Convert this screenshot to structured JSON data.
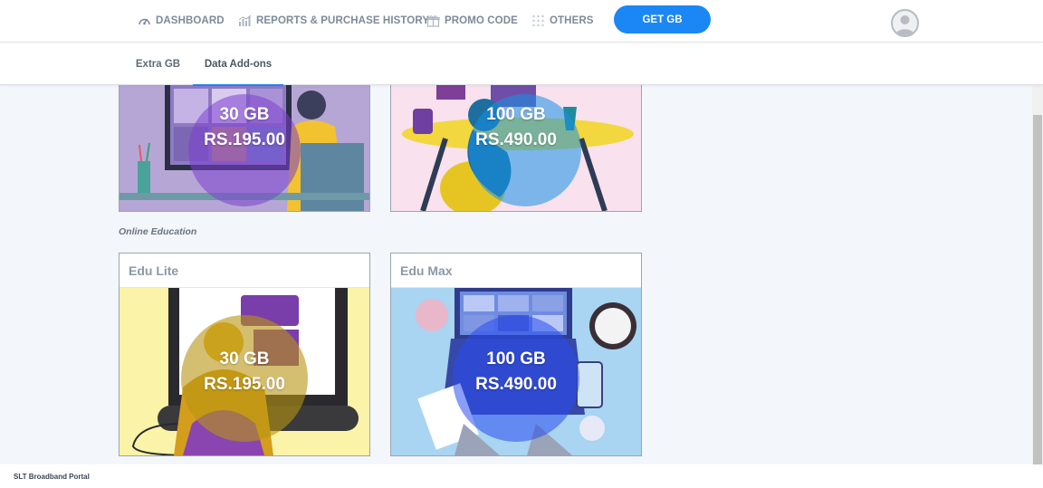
{
  "nav": {
    "items": [
      {
        "label": "DASHBOARD",
        "icon": "speedometer-icon"
      },
      {
        "label": "REPORTS & PURCHASE HISTORY",
        "icon": "bar-chart-icon"
      },
      {
        "label": "PROMO CODE",
        "icon": "gift-icon"
      },
      {
        "label": "OTHERS",
        "icon": "dots-grid-icon"
      }
    ],
    "cta_label": "GET GB"
  },
  "tabs": [
    {
      "label": "Extra GB",
      "active": false
    },
    {
      "label": "Data Add-ons",
      "active": true
    }
  ],
  "top_row": [
    {
      "size": "30 GB",
      "price": "RS.195.00"
    },
    {
      "size": "100 GB",
      "price": "RS.490.00"
    }
  ],
  "education": {
    "section_title": "Online Education",
    "cards": [
      {
        "title": "Edu Lite",
        "size": "30 GB",
        "price": "RS.195.00"
      },
      {
        "title": "Edu Max",
        "size": "100 GB",
        "price": "RS.490.00"
      }
    ]
  },
  "footer": {
    "text": "SLT Broadband Portal"
  },
  "colors": {
    "accent": "#1b87f5",
    "nav_text": "#7d8a9a",
    "content_bg": "#f3f6fa",
    "card_border": "#9aa6b4"
  }
}
